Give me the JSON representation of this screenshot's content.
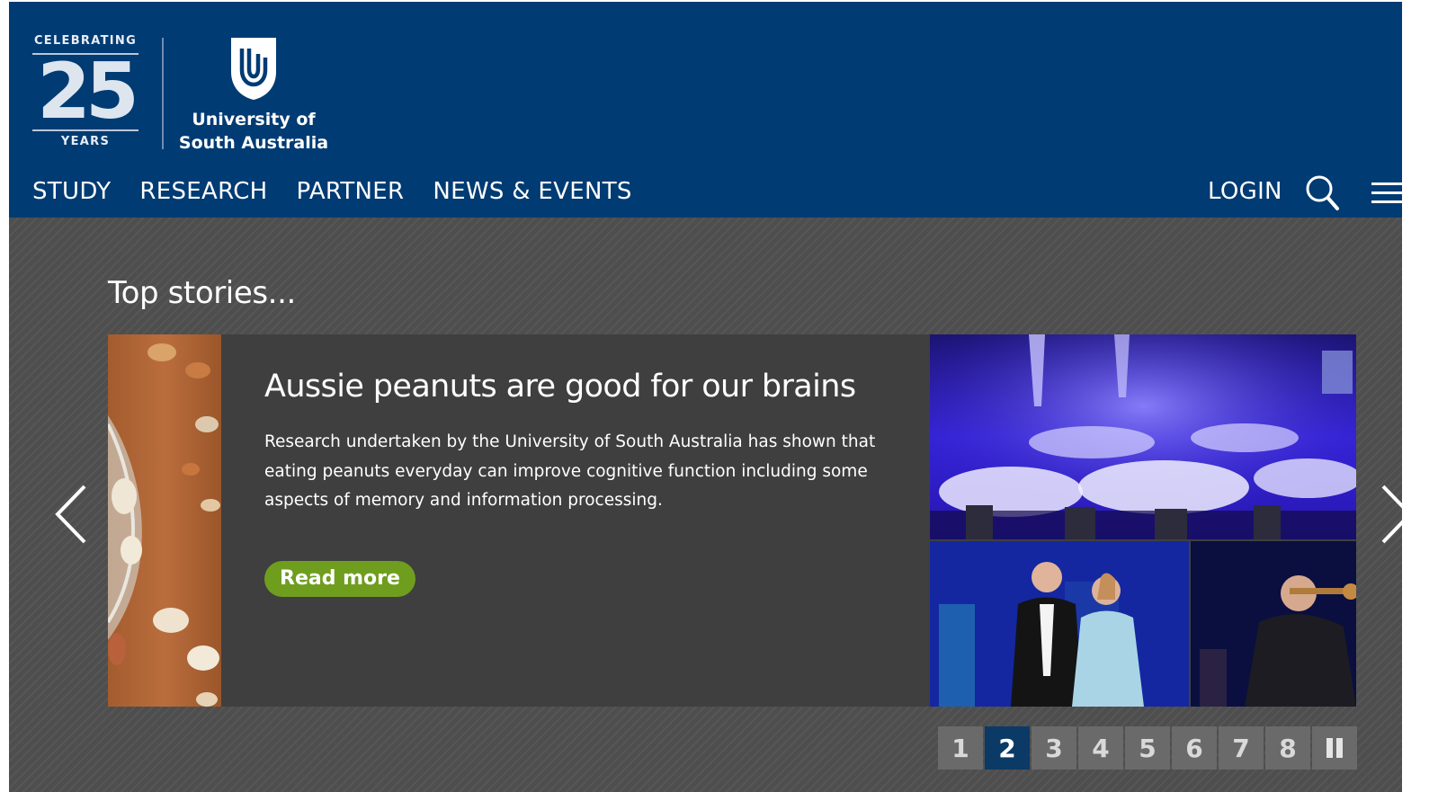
{
  "header": {
    "anniversary": {
      "top": "CELEBRATING",
      "number": "25",
      "bottom": "YEARS"
    },
    "university": {
      "line1": "University of",
      "line2": "South Australia"
    },
    "nav": [
      "STUDY",
      "RESEARCH",
      "PARTNER",
      "NEWS & EVENTS"
    ],
    "login_label": "LOGIN",
    "icons": {
      "search": "search-icon",
      "menu": "hamburger-menu-icon"
    },
    "background_color": "#003b73"
  },
  "carousel": {
    "section_title": "Top stories...",
    "slide": {
      "title": "Aussie peanuts are good for our brains",
      "text": "Research undertaken by the University of South Australia has shown that eating peanuts everyday can improve cognitive function including some aspects of memory and information processing.",
      "button_label": "Read more",
      "button_color": "#6f9e1f"
    },
    "pager": {
      "pages": [
        "1",
        "2",
        "3",
        "4",
        "5",
        "6",
        "7",
        "8"
      ],
      "active_page": "2",
      "pause_icon": "pause-icon"
    },
    "icons": {
      "prev": "chevron-left-icon",
      "next": "chevron-right-icon"
    }
  }
}
